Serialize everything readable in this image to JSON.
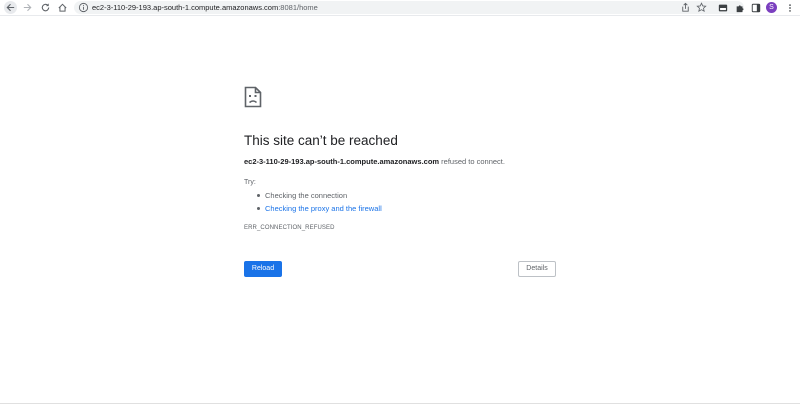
{
  "browser": {
    "url_host": "ec2-3-110-29-193.ap-south-1.compute.amazonaws.com",
    "url_rest": ":8081/home",
    "profile_initial": "S",
    "icons": [
      "back-icon",
      "forward-icon",
      "reload-icon",
      "home-icon",
      "info-icon",
      "share-icon",
      "star-icon",
      "extension-icon",
      "puzzle-icon",
      "side-panel-icon",
      "menu-icon"
    ]
  },
  "error_page": {
    "title": "This site can’t be reached",
    "host": "ec2-3-110-29-193.ap-south-1.compute.amazonaws.com",
    "message": " refused to connect.",
    "try_label": "Try:",
    "suggestions": [
      {
        "text": "Checking the connection",
        "is_link": false
      },
      {
        "text": "Checking the proxy and the firewall",
        "is_link": true
      }
    ],
    "error_code": "ERR_CONNECTION_REFUSED",
    "reload_label": "Reload",
    "details_label": "Details"
  },
  "colors": {
    "accent": "#1a73e8",
    "text_primary": "#202124",
    "text_secondary": "#5f6368",
    "avatar": "#7b3fbf"
  }
}
